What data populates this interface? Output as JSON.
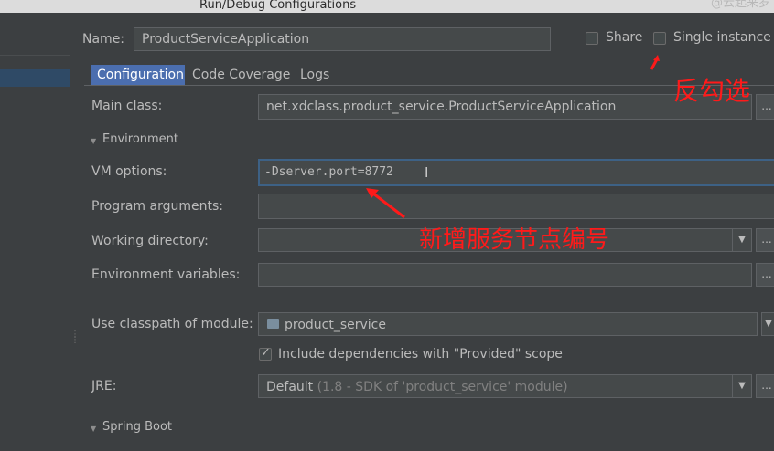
{
  "window": {
    "title": "Run/Debug Configurations",
    "watermark": "@云起来罗"
  },
  "config": {
    "name_label": "Name:",
    "name_value": "ProductServiceApplication",
    "share_label": "Share",
    "single_instance_label": "Single instance o",
    "tabs": [
      "Configuration",
      "Code Coverage",
      "Logs"
    ],
    "active_tab": "Configuration"
  },
  "form": {
    "main_class_label": "Main class:",
    "main_class_value": "net.xdclass.product_service.ProductServiceApplication",
    "environment_label": "Environment",
    "vm_options_label": "VM options:",
    "vm_options_value": "-Dserver.port=8772",
    "program_args_label": "Program arguments:",
    "working_dir_label": "Working directory:",
    "env_vars_label": "Environment variables:",
    "classpath_label": "Use classpath of module:",
    "classpath_value": "product_service",
    "include_deps_label": "Include dependencies with \"Provided\" scope",
    "jre_label": "JRE:",
    "jre_value": "Default",
    "jre_hint": "(1.8 - SDK of 'product_service' module)",
    "spring_boot_label": "Spring Boot",
    "dots": "...",
    "dots2": "...",
    "dots3": "...",
    "dots4": "...",
    "dots5": "...",
    "dots6": "..."
  },
  "annotations": {
    "uncheck": "反勾选",
    "new_port": "新增服务节点编号"
  },
  "colors": {
    "annotation": "#ff1a1a",
    "tab_active": "#4b6eaf",
    "focus_border": "#3d6185"
  }
}
